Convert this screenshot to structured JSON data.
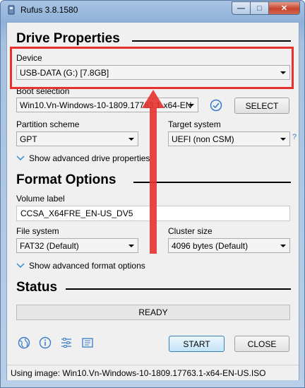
{
  "window": {
    "title": "Rufus 3.8.1580"
  },
  "drive_properties": {
    "heading": "Drive Properties",
    "device_label": "Device",
    "device_value": "USB-DATA (G:) [7.8GB]",
    "boot_selection_label": "Boot selection",
    "boot_selection_value": "Win10.Vn-Windows-10-1809.17763.1-x64-EN",
    "select_button": "SELECT",
    "partition_scheme_label": "Partition scheme",
    "partition_scheme_value": "GPT",
    "target_system_label": "Target system",
    "target_system_value": "UEFI (non CSM)",
    "help_mark": "?",
    "advanced_toggle": "Show advanced drive properties"
  },
  "format_options": {
    "heading": "Format Options",
    "volume_label_label": "Volume label",
    "volume_label_value": "CCSA_X64FRE_EN-US_DV5",
    "file_system_label": "File system",
    "file_system_value": "FAT32 (Default)",
    "cluster_size_label": "Cluster size",
    "cluster_size_value": "4096 bytes (Default)",
    "advanced_toggle": "Show advanced format options"
  },
  "status": {
    "heading": "Status",
    "progress_text": "READY"
  },
  "footer": {
    "start_button": "START",
    "close_button": "CLOSE",
    "status_bar": "Using image: Win10.Vn-Windows-10-1809.17763.1-x64-EN-US.ISO"
  },
  "colors": {
    "annotation": "#e5322f",
    "accent": "#3c7fb1"
  }
}
